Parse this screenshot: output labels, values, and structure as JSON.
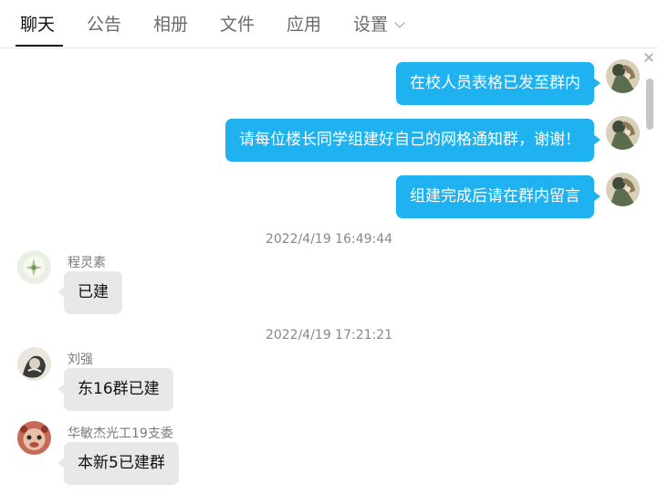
{
  "tabs": {
    "chat": "聊天",
    "announcement": "公告",
    "album": "相册",
    "files": "文件",
    "apps": "应用",
    "settings": "设置"
  },
  "messages": {
    "out1": "在校人员表格已发至群内",
    "out2": "请每位楼长同学组建好自己的网格通知群，谢谢！",
    "out3": "组建完成后请在群内留言",
    "time1": "2022/4/19 16:49:44",
    "sender1": "程灵素",
    "in1": "已建",
    "time2": "2022/4/19 17:21:21",
    "sender2": "刘强",
    "in2": "东16群已建",
    "sender3": "华敏杰光工19支委",
    "in3": "本新5已建群"
  },
  "colors": {
    "outgoing_bubble": "#1eb2f0",
    "incoming_bubble": "#e8e8e8"
  }
}
